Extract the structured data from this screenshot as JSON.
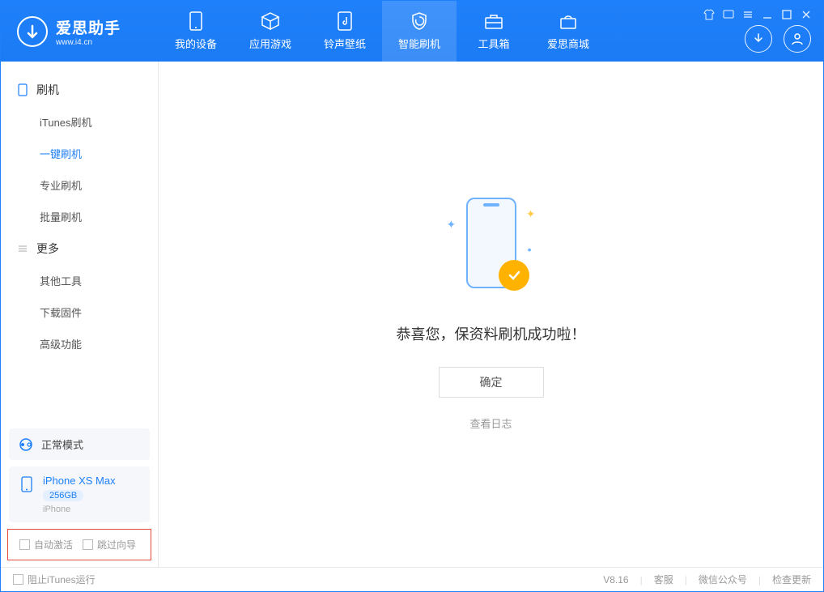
{
  "logo": {
    "title": "爱思助手",
    "subtitle": "www.i4.cn"
  },
  "nav": [
    {
      "label": "我的设备"
    },
    {
      "label": "应用游戏"
    },
    {
      "label": "铃声壁纸"
    },
    {
      "label": "智能刷机"
    },
    {
      "label": "工具箱"
    },
    {
      "label": "爱思商城"
    }
  ],
  "sidebar": {
    "group1_title": "刷机",
    "group1_items": [
      "iTunes刷机",
      "一键刷机",
      "专业刷机",
      "批量刷机"
    ],
    "group2_title": "更多",
    "group2_items": [
      "其他工具",
      "下载固件",
      "高级功能"
    ]
  },
  "device_status": {
    "label": "正常模式"
  },
  "device": {
    "name": "iPhone XS Max",
    "capacity": "256GB",
    "type": "iPhone"
  },
  "checkboxes": {
    "auto_activate": "自动激活",
    "skip_guide": "跳过向导"
  },
  "main": {
    "success_text": "恭喜您，保资料刷机成功啦！",
    "ok_button": "确定",
    "view_log": "查看日志"
  },
  "footer": {
    "block_itunes": "阻止iTunes运行",
    "version": "V8.16",
    "links": [
      "客服",
      "微信公众号",
      "检查更新"
    ]
  }
}
